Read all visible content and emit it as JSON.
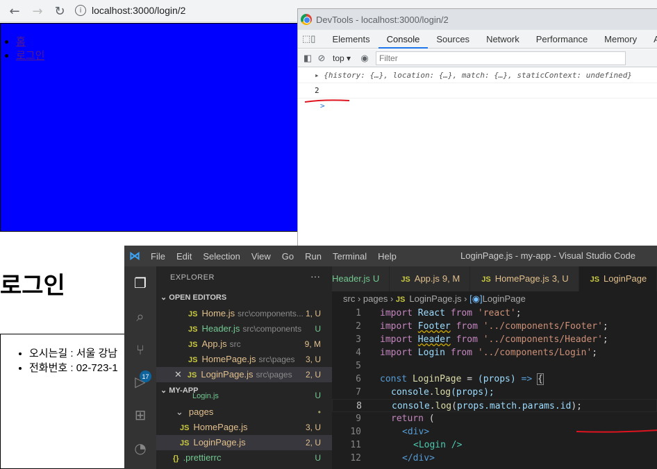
{
  "browser": {
    "url": "localhost:3000/login/2",
    "nav": [
      "홈",
      "로그인"
    ],
    "title": "로그인",
    "footer": [
      "오시는길 : 서울 강남",
      "전화번호 : 02-723-1"
    ]
  },
  "devtools": {
    "window_title": "DevTools - localhost:3000/login/2",
    "tabs": [
      "Elements",
      "Console",
      "Sources",
      "Network",
      "Performance",
      "Memory",
      "A"
    ],
    "context": "top",
    "filter_placeholder": "Filter",
    "console_lines": [
      "{history: {…}, location: {…}, match: {…}, staticContext: undefined}",
      "2"
    ],
    "prompt": ">"
  },
  "vscode": {
    "menu": [
      "File",
      "Edit",
      "Selection",
      "View",
      "Go",
      "Run",
      "Terminal",
      "Help"
    ],
    "window_title": "LoginPage.js - my-app - Visual Studio Code",
    "explorer_title": "EXPLORER",
    "open_editors_title": "OPEN EDITORS",
    "open_editors": [
      {
        "name": "Home.js",
        "path": "src\\components...",
        "status": "1, U"
      },
      {
        "name": "Header.js",
        "path": "src\\components",
        "status": "U"
      },
      {
        "name": "App.js",
        "path": "src",
        "status": "9, M"
      },
      {
        "name": "HomePage.js",
        "path": "src\\pages",
        "status": "3, U"
      },
      {
        "name": "LoginPage.js",
        "path": "src\\pages",
        "status": "2, U"
      }
    ],
    "project_title": "MY-APP",
    "project_files": [
      {
        "name": "Login.js",
        "status": "U"
      },
      {
        "name": "pages",
        "status": "•"
      },
      {
        "name": "HomePage.js",
        "status": "3, U"
      },
      {
        "name": "LoginPage.js",
        "status": "2, U"
      },
      {
        "name": ".prettierrc",
        "status": "U"
      }
    ],
    "badge": "17",
    "editor_tabs": [
      {
        "name": "Header.js",
        "status": "U"
      },
      {
        "name": "App.js",
        "status": "9, M"
      },
      {
        "name": "HomePage.js",
        "status": "3, U"
      },
      {
        "name": "LoginPage",
        "status": ""
      }
    ],
    "breadcrumb": [
      "src",
      "pages",
      "LoginPage.js",
      "LoginPage"
    ],
    "line_numbers": [
      "1",
      "2",
      "3",
      "4",
      "5",
      "6",
      "7",
      "8",
      "9",
      "10",
      "11",
      "12"
    ],
    "code": {
      "l1": [
        "import",
        "React",
        "from",
        "'react'",
        ";"
      ],
      "l2": [
        "import",
        "Footer",
        "from",
        "'../components/Footer'",
        ";"
      ],
      "l3": [
        "import",
        "Header",
        "from",
        "'../components/Header'",
        ";"
      ],
      "l4": [
        "import",
        "Login",
        "from",
        "'../components/Login'",
        ";"
      ],
      "l6": [
        "const",
        "LoginPage",
        "=",
        "(props)",
        "=>",
        "{"
      ],
      "l7": [
        "console",
        ".",
        "log",
        "(props);"
      ],
      "l8": [
        "console",
        ".",
        "log",
        "(",
        "props.match.params.id",
        ");"
      ],
      "l9": [
        "return",
        "("
      ],
      "l10": [
        "<div>"
      ],
      "l11": [
        "<Login />"
      ],
      "l12": [
        "</div>"
      ]
    }
  },
  "colors": {
    "header_bg": "#0000ff",
    "annotation": "#e0141e",
    "vscode_bg": "#1e1e1e"
  }
}
